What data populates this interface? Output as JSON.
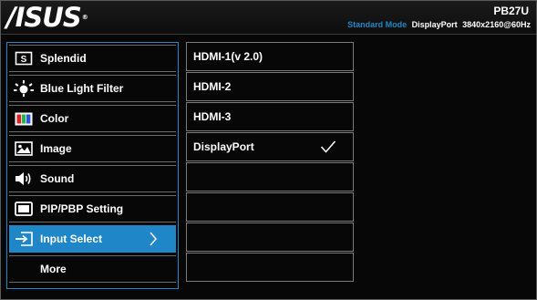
{
  "header": {
    "brand": "/ISUS",
    "model": "PB27U",
    "mode_label": "Standard Mode",
    "input_port": "DisplayPort",
    "resolution": "3840x2160@60Hz"
  },
  "menu": {
    "items": [
      {
        "label": "Splendid",
        "icon": "splendid-icon"
      },
      {
        "label": "Blue Light Filter",
        "icon": "blue-light-filter-icon"
      },
      {
        "label": "Color",
        "icon": "color-icon"
      },
      {
        "label": "Image",
        "icon": "image-icon"
      },
      {
        "label": "Sound",
        "icon": "sound-icon"
      },
      {
        "label": "PIP/PBP Setting",
        "icon": "pip-pbp-icon"
      },
      {
        "label": "Input Select",
        "icon": "input-select-icon",
        "selected": true
      },
      {
        "label": "More",
        "icon": ""
      }
    ]
  },
  "submenu": {
    "options": [
      {
        "label": "HDMI-1(v 2.0)"
      },
      {
        "label": "HDMI-2"
      },
      {
        "label": "HDMI-3"
      },
      {
        "label": "DisplayPort",
        "checked": true
      },
      {
        "label": ""
      },
      {
        "label": ""
      },
      {
        "label": ""
      },
      {
        "label": ""
      }
    ]
  },
  "colors": {
    "accent": "#1f86c8",
    "background": "#070707",
    "text": "#ffffff"
  }
}
